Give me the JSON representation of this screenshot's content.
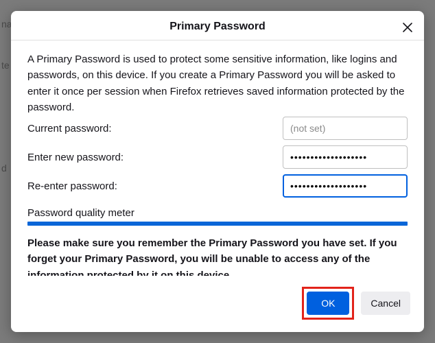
{
  "dialog": {
    "title": "Primary Password",
    "description": "A Primary Password is used to protect some sensitive information, like logins and passwords, on this device. If you create a Primary Password you will be asked to enter it once per session when Firefox retrieves saved information protected by the password.",
    "fields": {
      "current": {
        "label": "Current password:",
        "placeholder": "(not set)",
        "value": ""
      },
      "new": {
        "label": "Enter new password:",
        "value": "•••••••••••••••••••"
      },
      "reenter": {
        "label": "Re-enter password:",
        "value": "•••••••••••••••••••"
      }
    },
    "meter_label": "Password quality meter",
    "meter_percent": 100,
    "warning": "Please make sure you remember the Primary Password you have set. If you forget your Primary Password, you will be unable to access any of the information protected by it on this device.",
    "buttons": {
      "ok": "OK",
      "cancel": "Cancel"
    }
  },
  "background_fragments": [
    "na",
    "te",
    "d "
  ]
}
